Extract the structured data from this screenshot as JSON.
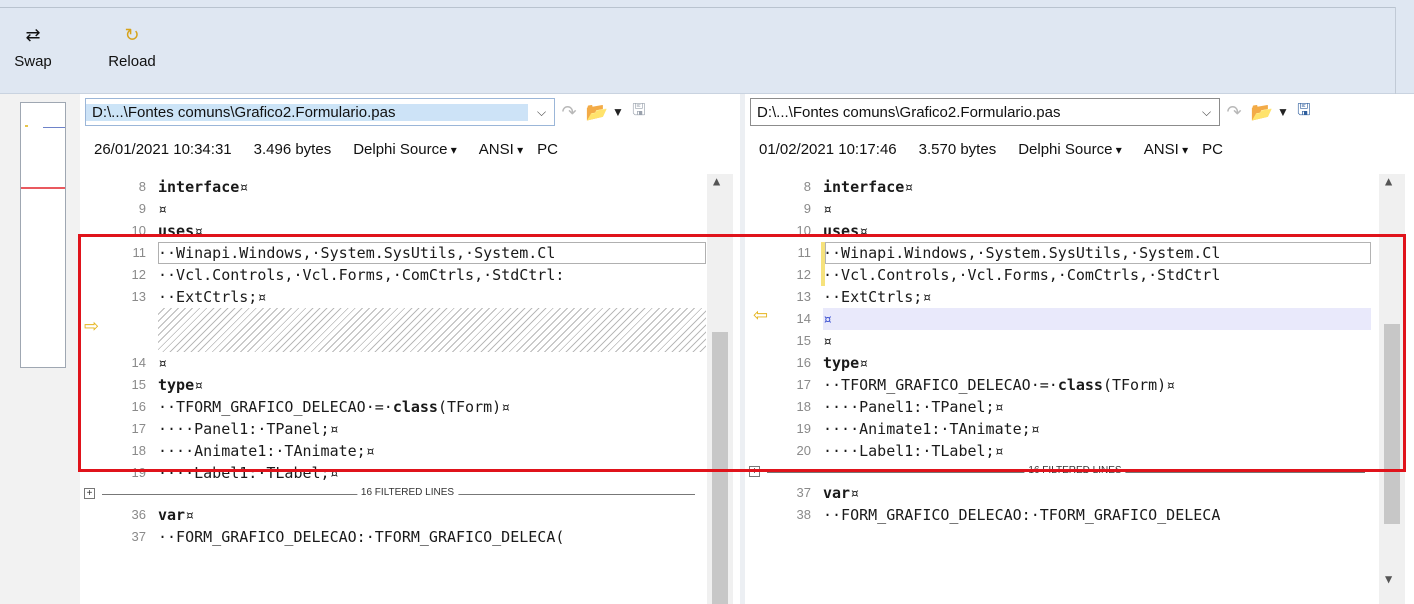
{
  "toolbar": {
    "swap_label": "Swap",
    "reload_label": "Reload",
    "swap_icon": "swap-icon",
    "reload_icon": "reload-icon"
  },
  "left": {
    "path": "D:\\...\\Fontes comuns\\Grafico2.Formulario.pas",
    "date": "26/01/2021 10:34:31",
    "size": "3.496 bytes",
    "format": "Delphi Source",
    "encoding": "ANSI",
    "lineend": "PC",
    "lines": [
      {
        "n": "8",
        "t": "interface¤"
      },
      {
        "n": "9",
        "t": "¤"
      },
      {
        "n": "10",
        "t": "uses¤"
      },
      {
        "n": "11",
        "t": "··Winapi.Windows,·System.SysUtils,·System.Cl"
      },
      {
        "n": "12",
        "t": "··Vcl.Controls,·Vcl.Forms,·ComCtrls,·StdCtrl:"
      },
      {
        "n": "13",
        "t": "··ExtCtrls;¤"
      },
      {
        "n": "14",
        "t": "¤"
      },
      {
        "n": "15",
        "t": "type¤"
      },
      {
        "n": "16",
        "t": "··TFORM_GRAFICO_DELECAO·=·class(TForm)¤"
      },
      {
        "n": "17",
        "t": "····Panel1:·TPanel;¤"
      },
      {
        "n": "18",
        "t": "····Animate1:·TAnimate;¤"
      },
      {
        "n": "19",
        "t": "····Label1:·TLabel;¤"
      },
      {
        "n": "36",
        "t": "var¤"
      },
      {
        "n": "37",
        "t": "··FORM_GRAFICO_DELECAO:·TFORM_GRAFICO_DELECA("
      }
    ],
    "filtered": "16 FILTERED LINES"
  },
  "right": {
    "path": "D:\\...\\Fontes comuns\\Grafico2.Formulario.pas",
    "date": "01/02/2021 10:17:46",
    "size": "3.570 bytes",
    "format": "Delphi Source",
    "encoding": "ANSI",
    "lineend": "PC",
    "lines": [
      {
        "n": "8",
        "t": "interface¤"
      },
      {
        "n": "9",
        "t": "¤"
      },
      {
        "n": "10",
        "t": "uses¤"
      },
      {
        "n": "11",
        "t": "··Winapi.Windows,·System.SysUtils,·System.Cl"
      },
      {
        "n": "12",
        "t": "··Vcl.Controls,·Vcl.Forms,·ComCtrls,·StdCtrl"
      },
      {
        "n": "13",
        "t": "··ExtCtrls;¤"
      },
      {
        "n": "14",
        "t": "¤"
      },
      {
        "n": "15",
        "t": "¤"
      },
      {
        "n": "16",
        "t": "type¤"
      },
      {
        "n": "17",
        "t": "··TFORM_GRAFICO_DELECAO·=·class(TForm)¤"
      },
      {
        "n": "18",
        "t": "····Panel1:·TPanel;¤"
      },
      {
        "n": "19",
        "t": "····Animate1:·TAnimate;¤"
      },
      {
        "n": "20",
        "t": "····Label1:·TLabel;¤"
      },
      {
        "n": "37",
        "t": "var¤"
      },
      {
        "n": "38",
        "t": "··FORM_GRAFICO_DELECAO:·TFORM_GRAFICO_DELECA"
      }
    ],
    "filtered": "16 FILTERED LINES"
  },
  "colors": {
    "highlight": "#e0131b",
    "arrow": "#e5b51f",
    "insert_bg": "#e9e9fb"
  }
}
